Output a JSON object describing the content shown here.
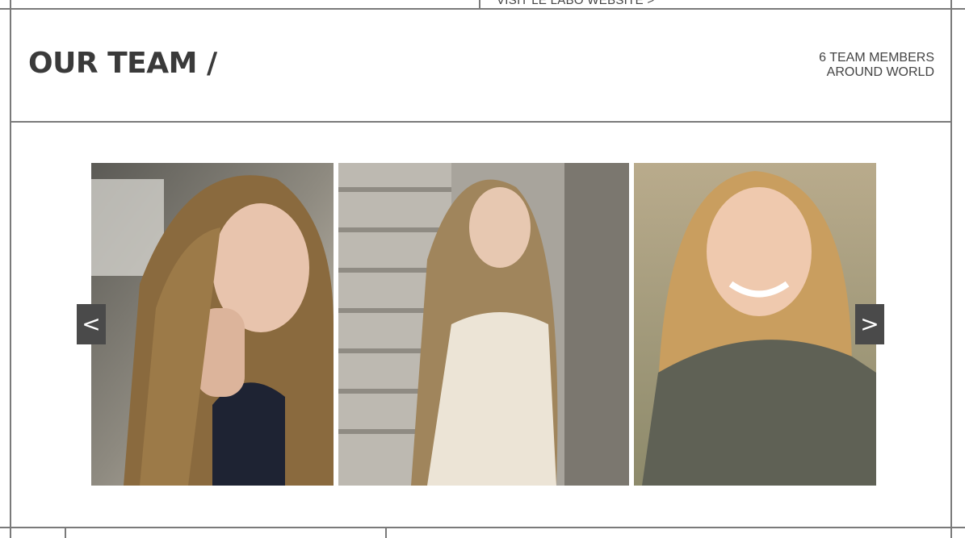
{
  "header": {
    "top_link": "VISIT LE LABO WEBSITE >",
    "title": "OUR TEAM /",
    "members_line1": "6 TEAM MEMBERS",
    "members_line2": "AROUND WORLD"
  },
  "carousel": {
    "prev_label": "<",
    "next_label": ">",
    "slides": [
      {
        "name": "team-member-photo-1"
      },
      {
        "name": "team-member-photo-2"
      },
      {
        "name": "team-member-photo-3"
      }
    ]
  },
  "colors": {
    "border": "#7a7a7a",
    "arrow_bg": "#4a4a4a",
    "text": "#444444"
  }
}
